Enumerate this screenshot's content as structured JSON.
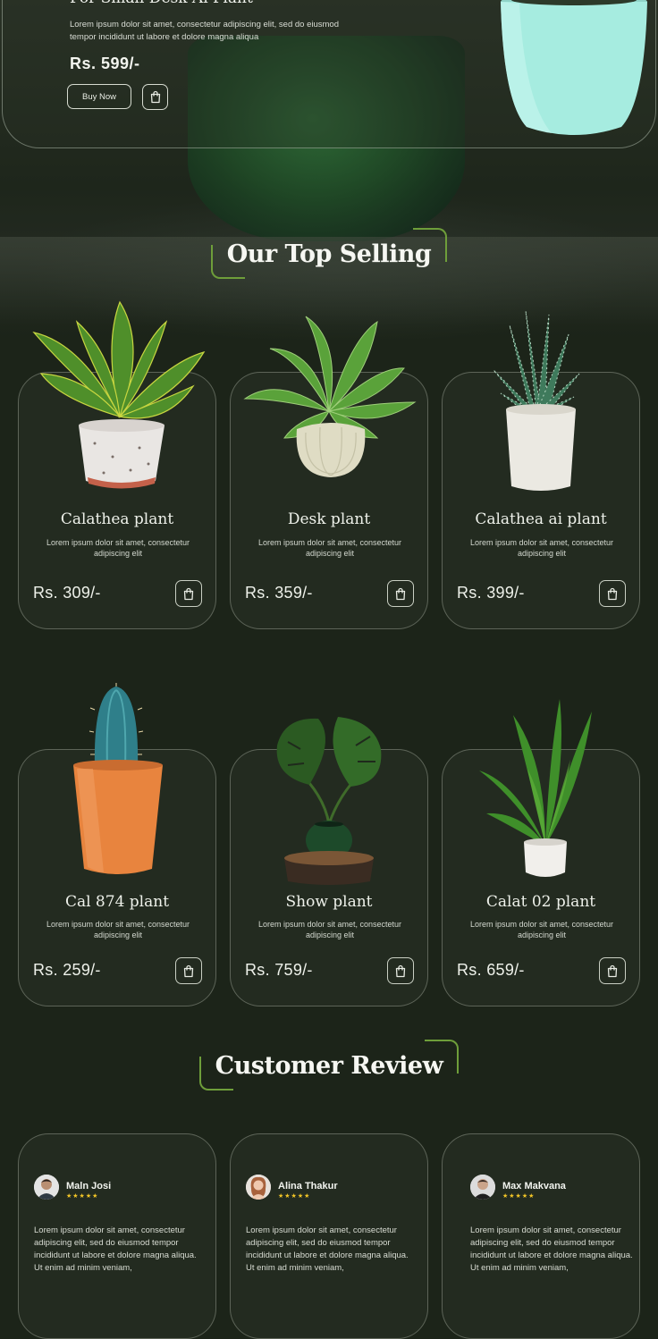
{
  "hero": {
    "title": "For Small Desk Ai Plant",
    "description": "Lorem ipsum dolor sit amet, consectetur adipiscing elit, sed do eiusmod tempor incididunt ut labore et dolore magna aliqua",
    "price": "Rs. 599/-",
    "buy_label": "Buy Now"
  },
  "top_selling": {
    "heading": "Our Top Selling",
    "products": [
      {
        "name": "Calathea plant",
        "desc": "Lorem ipsum dolor sit amet, consectetur adipiscing elit",
        "price": "Rs. 309/-"
      },
      {
        "name": "Desk plant",
        "desc": "Lorem ipsum dolor sit amet, consectetur adipiscing elit",
        "price": "Rs. 359/-"
      },
      {
        "name": "Calathea ai plant",
        "desc": "Lorem ipsum dolor sit amet, consectetur adipiscing elit",
        "price": "Rs. 399/-"
      },
      {
        "name": "Cal 874 plant",
        "desc": "Lorem ipsum dolor sit amet, consectetur adipiscing elit",
        "price": "Rs. 259/-"
      },
      {
        "name": "Show plant",
        "desc": "Lorem ipsum dolor sit amet, consectetur adipiscing elit",
        "price": "Rs. 759/-"
      },
      {
        "name": "Calat 02 plant",
        "desc": "Lorem ipsum dolor sit amet, consectetur adipiscing elit",
        "price": "Rs. 659/-"
      }
    ]
  },
  "reviews": {
    "heading": "Customer Review",
    "items": [
      {
        "name": "Maln Josi",
        "stars": "★★★★★",
        "text": "Lorem ipsum dolor sit amet, consectetur adipiscing elit, sed do eiusmod tempor incididunt ut labore et dolore magna aliqua. Ut enim ad minim veniam,"
      },
      {
        "name": "Alina Thakur",
        "stars": "★★★★★",
        "text": "Lorem ipsum dolor sit amet, consectetur adipiscing elit, sed do eiusmod tempor incididunt ut labore et dolore magna aliqua. Ut enim ad minim veniam,"
      },
      {
        "name": "Max Makvana",
        "stars": "★★★★★",
        "text": "Lorem ipsum dolor sit amet, consectetur adipiscing elit, sed do eiusmod tempor incididunt ut labore et dolore magna aliqua. Ut enim ad minim veniam,"
      }
    ]
  },
  "icons": {
    "cart": "shopping-bag-icon",
    "star": "star-icon"
  },
  "colors": {
    "background": "#1c2419",
    "accent": "#6e9e3a",
    "star": "#f2c526"
  }
}
